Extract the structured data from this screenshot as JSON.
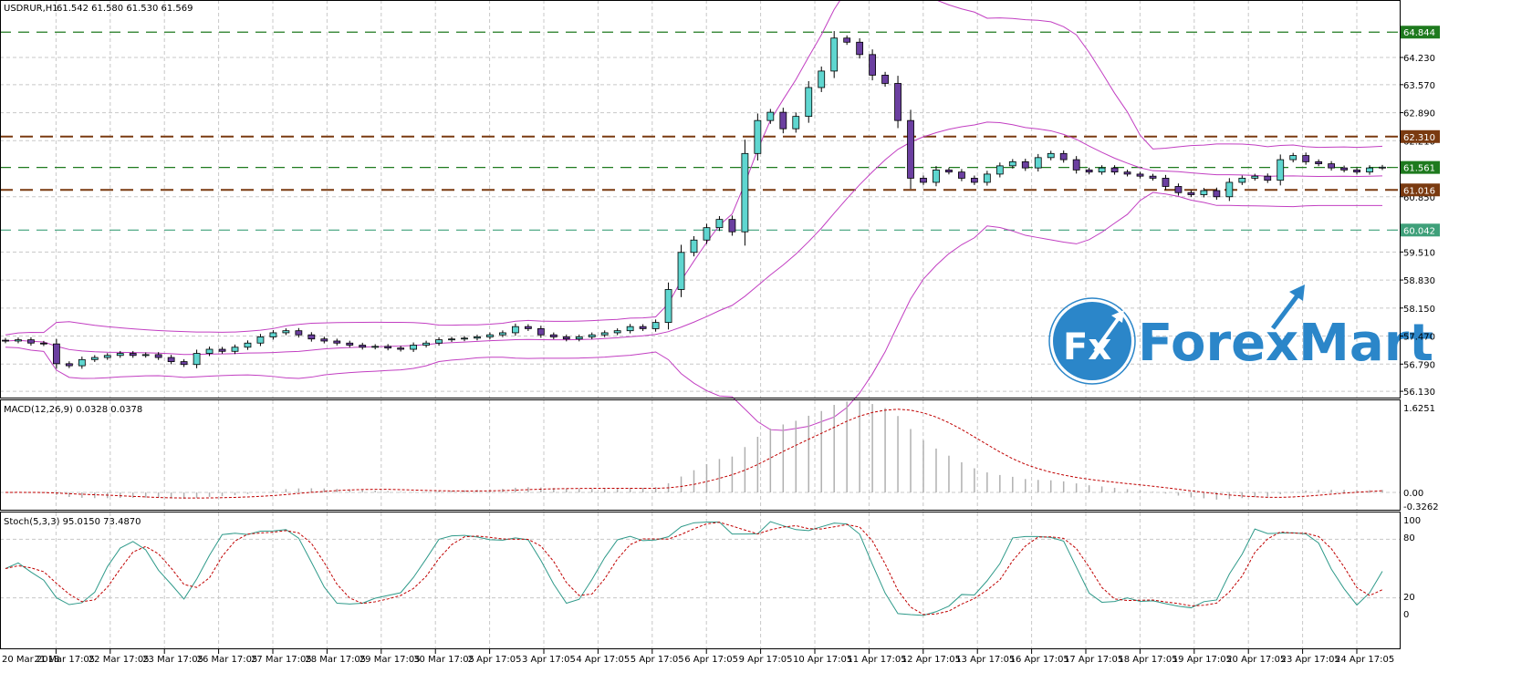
{
  "header": {
    "symbol": "USDRUR,H1",
    "ohlc": "61.542 61.580 61.530 61.569"
  },
  "macd": {
    "label": "MACD(12,26,9) 0.0328 0.0378",
    "ticks": [
      "1.6251",
      "0.00",
      "-0.3262"
    ]
  },
  "stoch": {
    "label": "Stoch(5,3,3) 95.0150 73.4870",
    "ticks": [
      "100",
      "80",
      "20",
      "0"
    ]
  },
  "logo": {
    "mark": "Fx",
    "text": "ForexMart"
  },
  "colors": {
    "bull": "#5fd6d0",
    "bear": "#6b3fa0",
    "bands": "#c23fc2",
    "stoch_main": "#2f9a8a",
    "stoch_signal": "#c00000",
    "logo": "#2b86c9"
  },
  "chart_data": {
    "type": "candlestick",
    "title": "USDRUR,H1",
    "price_ticks": [
      "64.230",
      "63.570",
      "62.890",
      "62.210",
      "60.850",
      "59.510",
      "58.830",
      "58.150",
      "57.470",
      "56.790",
      "56.130"
    ],
    "price_tick_values": [
      64.23,
      63.57,
      62.89,
      62.21,
      60.85,
      59.51,
      58.83,
      58.15,
      57.47,
      56.79,
      56.13
    ],
    "levels": [
      {
        "label": "64.844",
        "value": 64.844,
        "color": "#1e7a1e",
        "style": "green"
      },
      {
        "label": "62.310",
        "value": 62.31,
        "color": "#7a3a10",
        "style": "brown"
      },
      {
        "label": "61.561",
        "value": 61.561,
        "color": "#1e7a1e",
        "style": "green"
      },
      {
        "label": "61.016",
        "value": 61.016,
        "color": "#7a3a10",
        "style": "brown"
      },
      {
        "label": "60.042",
        "value": 60.042,
        "color": "#3fa07a",
        "style": "teal"
      }
    ],
    "x_labels": [
      "20 Mar 2018",
      "21 Mar 17:05",
      "22 Mar 17:05",
      "23 Mar 17:05",
      "26 Mar 17:05",
      "27 Mar 17:05",
      "28 Mar 17:05",
      "29 Mar 17:05",
      "30 Mar 17:05",
      "2 Apr 17:05",
      "3 Apr 17:05",
      "4 Apr 17:05",
      "5 Apr 17:05",
      "6 Apr 17:05",
      "9 Apr 17:05",
      "10 Apr 17:05",
      "11 Apr 17:05",
      "12 Apr 17:05",
      "13 Apr 17:05",
      "16 Apr 17:05",
      "17 Apr 17:05",
      "18 Apr 17:05",
      "19 Apr 17:05",
      "20 Apr 17:05",
      "23 Apr 17:05",
      "24 Apr 17:05"
    ],
    "closes": [
      57.35,
      57.38,
      57.3,
      57.28,
      56.8,
      56.75,
      56.9,
      56.95,
      57.0,
      57.05,
      57.0,
      57.02,
      56.95,
      56.85,
      56.78,
      57.05,
      57.15,
      57.1,
      57.2,
      57.3,
      57.45,
      57.55,
      57.6,
      57.5,
      57.4,
      57.35,
      57.3,
      57.25,
      57.2,
      57.22,
      57.18,
      57.15,
      57.25,
      57.3,
      57.38,
      57.4,
      57.42,
      57.45,
      57.5,
      57.55,
      57.7,
      57.65,
      57.5,
      57.45,
      57.4,
      57.45,
      57.5,
      57.55,
      57.6,
      57.7,
      57.65,
      57.8,
      58.6,
      59.5,
      59.8,
      60.1,
      60.3,
      60.0,
      61.9,
      62.7,
      62.9,
      62.5,
      62.8,
      63.5,
      63.9,
      64.7,
      64.6,
      64.3,
      63.8,
      63.6,
      62.7,
      61.3,
      61.2,
      61.5,
      61.45,
      61.3,
      61.2,
      61.4,
      61.6,
      61.7,
      61.55,
      61.8,
      61.9,
      61.75,
      61.5,
      61.45,
      61.55,
      61.45,
      61.4,
      61.35,
      61.3,
      61.1,
      60.95,
      60.9,
      61.0,
      60.85,
      61.2,
      61.3,
      61.35,
      61.25,
      61.75,
      61.85,
      61.7,
      61.65,
      61.55,
      61.5,
      61.45,
      61.55,
      61.569
    ]
  }
}
